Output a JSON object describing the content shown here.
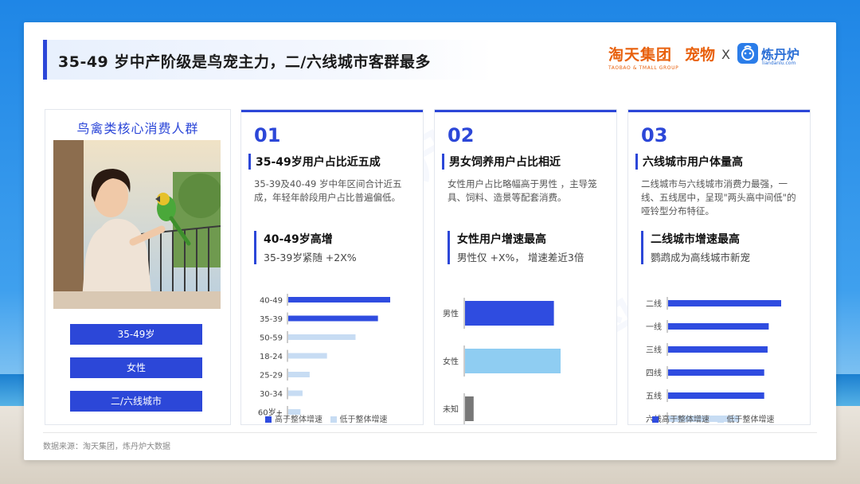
{
  "header": {
    "title": "35-49 岁中产阶级是鸟宠主力，二/六线城市客群最多",
    "brand_tmall_cn": "淘天集团",
    "brand_tmall_en": "TAOBAO & TMALL GROUP",
    "brand_pet": "宠物",
    "brand_x": "X",
    "brand_ldl_cn": "炼丹炉",
    "brand_ldl_en": "liandanlu.com"
  },
  "left": {
    "title": "鸟禽类核心消费人群",
    "tags": [
      "35-49岁",
      "女性",
      "二/六线城市"
    ]
  },
  "panels": [
    {
      "num": "01",
      "heading": "35-49岁用户占比近五成",
      "desc": "35-39及40-49 岁中年区间合计近五成，年轻年龄段用户占比普遍偏低。",
      "sub_a": "40-49岁高增",
      "sub_b": "35-39岁紧随 +2X%",
      "legend_high": "高于整体增速",
      "legend_low": "低于整体增速"
    },
    {
      "num": "02",
      "heading": "男女饲养用户占比相近",
      "desc": "女性用户占比略幅高于男性 ，主导笼具、饲料、造景等配套消费。",
      "sub_a": "女性用户增速最高",
      "sub_b": "男性仅 +X%， 增速差近3倍"
    },
    {
      "num": "03",
      "heading": "六线城市用户体量高",
      "desc": "二线城市与六线城市消费力最强，一线、五线居中，呈现\"两头高中间低\"的哑铃型分布特征。",
      "sub_a": "二线城市增速最高",
      "sub_b": "鹦鹉成为高线城市新宠",
      "legend_high": "高于整体增速",
      "legend_low": "低于整体增速"
    }
  ],
  "footer": "数据来源：淘天集团，炼丹炉大数据",
  "colors": {
    "accent": "#2c47d8",
    "high": "#2f4ce0",
    "low": "#c7dcf3",
    "female": "#8fcdf2",
    "unknown": "#777777"
  },
  "chart_data": [
    {
      "type": "bar",
      "orientation": "horizontal",
      "categories": [
        "40-49",
        "35-39",
        "50-59",
        "18-24",
        "25-29",
        "30-34",
        "60岁+"
      ],
      "values": [
        100,
        88,
        66,
        38,
        21,
        14,
        12
      ],
      "highlight": [
        "high",
        "high",
        "low",
        "low",
        "low",
        "low",
        "low"
      ],
      "legend": [
        "高于整体增速",
        "低于整体增速"
      ]
    },
    {
      "type": "bar",
      "orientation": "horizontal",
      "categories": [
        "男性",
        "女性",
        "未知"
      ],
      "values": [
        93,
        100,
        9
      ],
      "colors": [
        "#2f4ce0",
        "#8fcdf2",
        "#777777"
      ]
    },
    {
      "type": "bar",
      "orientation": "horizontal",
      "categories": [
        "二线",
        "一线",
        "三线",
        "四线",
        "五线",
        "六线"
      ],
      "values": [
        100,
        89,
        88,
        85,
        85,
        63
      ],
      "highlight": [
        "high",
        "high",
        "high",
        "high",
        "high",
        "low"
      ],
      "legend": [
        "高于整体增速",
        "低于整体增速"
      ]
    }
  ]
}
